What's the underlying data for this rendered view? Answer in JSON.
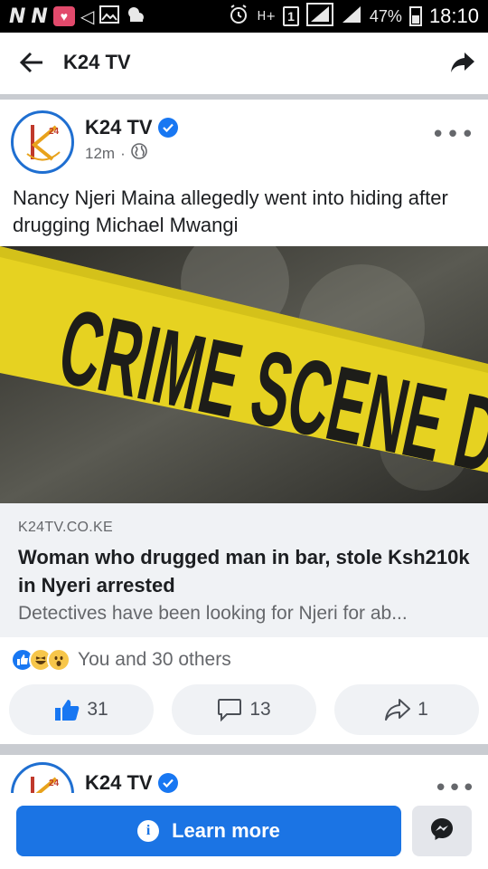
{
  "status_bar": {
    "left_icons": [
      "n-icon",
      "n-icon",
      "heart-app-icon",
      "telegram-icon",
      "gallery-icon",
      "weather-icon"
    ],
    "n_glyph": "N",
    "network_label": "H+",
    "sim_label": "1",
    "battery_percent": "47%",
    "battery_level": 0.47,
    "time": "18:10"
  },
  "app_bar": {
    "title": "K24 TV",
    "back_icon": "arrow-left-icon",
    "share_icon": "share-arrow-icon"
  },
  "post": {
    "page_name": "K24 TV",
    "verified": true,
    "time_ago": "12m",
    "separator": "·",
    "audience_icon": "globe-icon",
    "more_icon": "more-dots-icon",
    "text": "Nancy Njeri Maina allegedly went into hiding after drugging Michael Mwangi",
    "image_text": "CRIME SCENE DO NOT CROSS",
    "link": {
      "domain": "K24TV.CO.KE",
      "title": "Woman who drugged man in bar, stole Ksh210k in Nyeri arrested",
      "description": "Detectives have been looking for Njeri for ab..."
    },
    "reactions": {
      "icons": [
        "like-reaction-icon",
        "haha-reaction-icon",
        "wow-reaction-icon"
      ],
      "summary": "You and 30 others"
    },
    "actions": {
      "like_count": "31",
      "comment_count": "13",
      "share_count": "1"
    }
  },
  "next_post": {
    "page_name": "K24 TV",
    "verified": true
  },
  "cta": {
    "learn_more_label": "Learn more",
    "messenger_icon": "messenger-icon"
  },
  "colors": {
    "facebook_blue": "#1b74e4",
    "verified_blue": "#1877f2",
    "tape_yellow": "#e6d221",
    "avatar_ring": "#1f6fd1"
  }
}
